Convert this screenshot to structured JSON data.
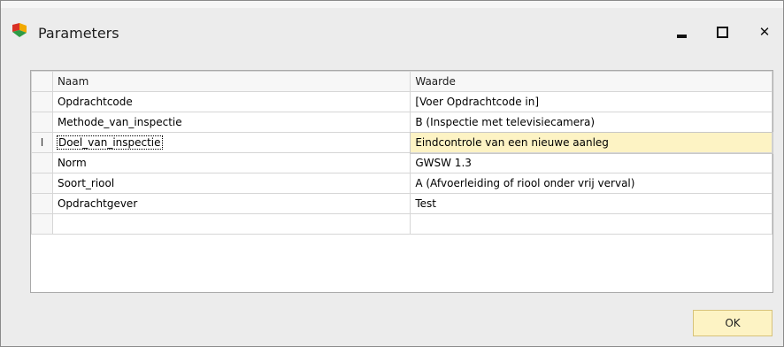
{
  "window": {
    "title": "Parameters",
    "icon": "app-logo-icon",
    "controls": {
      "minimize": "minimize-icon",
      "maximize": "maximize-icon",
      "close": "close-icon"
    }
  },
  "grid": {
    "headers": {
      "name": "Naam",
      "value": "Waarde"
    },
    "rows": [
      {
        "name": "Opdrachtcode",
        "value": "[Voer Opdrachtcode in]"
      },
      {
        "name": "Methode_van_inspectie",
        "value": "B (Inspectie met televisiecamera)"
      },
      {
        "name": "Doel_van_inspectie",
        "value": "Eindcontrole van een nieuwe aanleg"
      },
      {
        "name": "Norm",
        "value": "GWSW 1.3"
      },
      {
        "name": "Soort_riool",
        "value": "A (Afvoerleiding of riool onder vrij verval)"
      },
      {
        "name": "Opdrachtgever",
        "value": "Test"
      }
    ],
    "selected_row_indicator": "I"
  },
  "buttons": {
    "ok": "OK"
  },
  "colors": {
    "highlight": "#fdf3c4",
    "window_bg": "#ececec"
  }
}
